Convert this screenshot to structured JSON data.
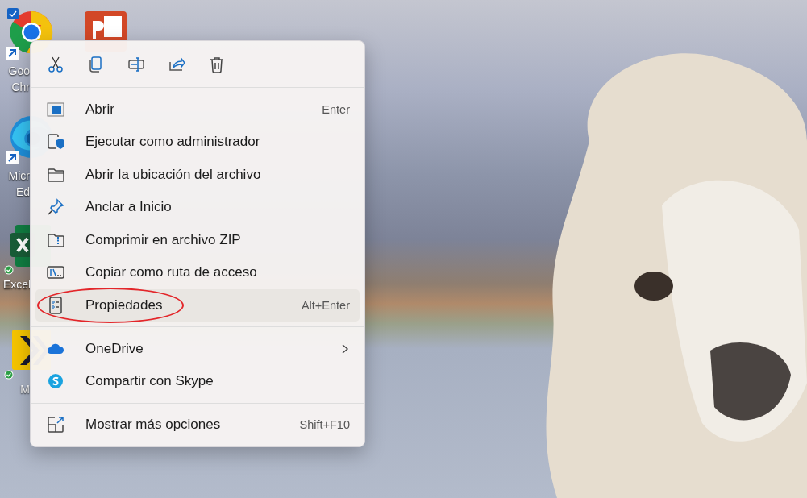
{
  "desktop_icons": [
    {
      "label_lines": [
        "Goo",
        "Chr"
      ],
      "selected": true,
      "shortcut": true,
      "synced": false
    },
    {
      "selected": false,
      "shortcut": false,
      "synced": false
    },
    {
      "label_lines": [
        "Micr",
        "Ed"
      ],
      "selected": false,
      "shortcut": true,
      "synced": false
    },
    {
      "label_lines": [
        "Excel"
      ],
      "selected": false,
      "shortcut": false,
      "synced": true
    },
    {
      "label_lines": [
        "M"
      ],
      "selected": false,
      "shortcut": false,
      "synced": true
    }
  ],
  "context_menu": {
    "groups": [
      {
        "items": [
          {
            "label": "Abrir",
            "shortcut": "Enter",
            "highlighted": false,
            "circled": false,
            "submenu": false
          },
          {
            "label": "Ejecutar como administrador",
            "highlighted": false,
            "circled": false,
            "submenu": false
          },
          {
            "label": "Abrir la ubicación del archivo",
            "highlighted": false,
            "circled": false,
            "submenu": false
          },
          {
            "label": "Anclar a Inicio",
            "highlighted": false,
            "circled": false,
            "submenu": false
          },
          {
            "label": "Comprimir en archivo ZIP",
            "highlighted": false,
            "circled": false,
            "submenu": false
          },
          {
            "label": "Copiar como ruta de acceso",
            "highlighted": false,
            "circled": false,
            "submenu": false
          },
          {
            "label": "Propiedades",
            "shortcut": "Alt+Enter",
            "highlighted": true,
            "circled": true,
            "submenu": false
          }
        ]
      },
      {
        "items": [
          {
            "label": "OneDrive",
            "highlighted": false,
            "circled": false,
            "submenu": true
          },
          {
            "label": "Compartir con Skype",
            "highlighted": false,
            "circled": false,
            "submenu": false
          }
        ]
      },
      {
        "items": [
          {
            "label": "Mostrar más opciones",
            "shortcut": "Shift+F10",
            "highlighted": false,
            "circled": false,
            "submenu": false
          }
        ]
      }
    ]
  }
}
